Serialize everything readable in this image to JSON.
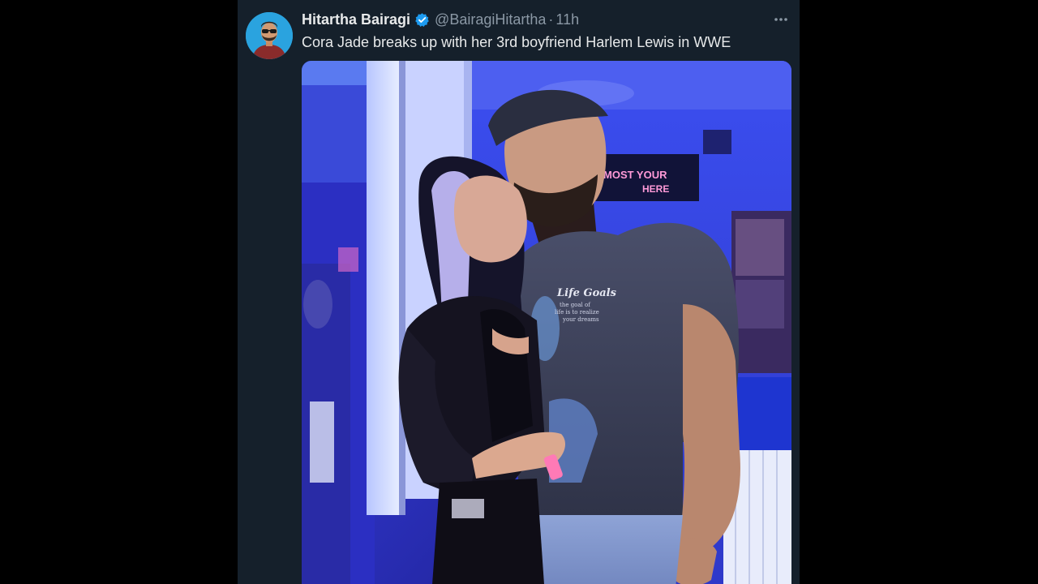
{
  "tweet": {
    "author": {
      "display_name": "Hitartha Bairagi",
      "handle": "@BairagiHitartha",
      "verified": true
    },
    "separator": "·",
    "timestamp": "11h",
    "text": "Cora Jade breaks up with her 3rd boyfriend Harlem Lewis in WWE",
    "more_icon": "more-horizontal-icon",
    "media": {
      "alt": "Photo of a couple posing in a blue-lit bar",
      "shirt_print_title": "Life Goals",
      "shirt_print_lines": [
        "the goal of",
        "life is to realize",
        "your dreams"
      ],
      "neon_sign_lines": [
        "MOST YOUR",
        "HERE"
      ]
    }
  },
  "colors": {
    "page_background": "#000000",
    "card_background": "#15202b",
    "primary_text": "#e7e9ea",
    "secondary_text": "#8b98a5",
    "verified_blue": "#1d9bf0"
  }
}
